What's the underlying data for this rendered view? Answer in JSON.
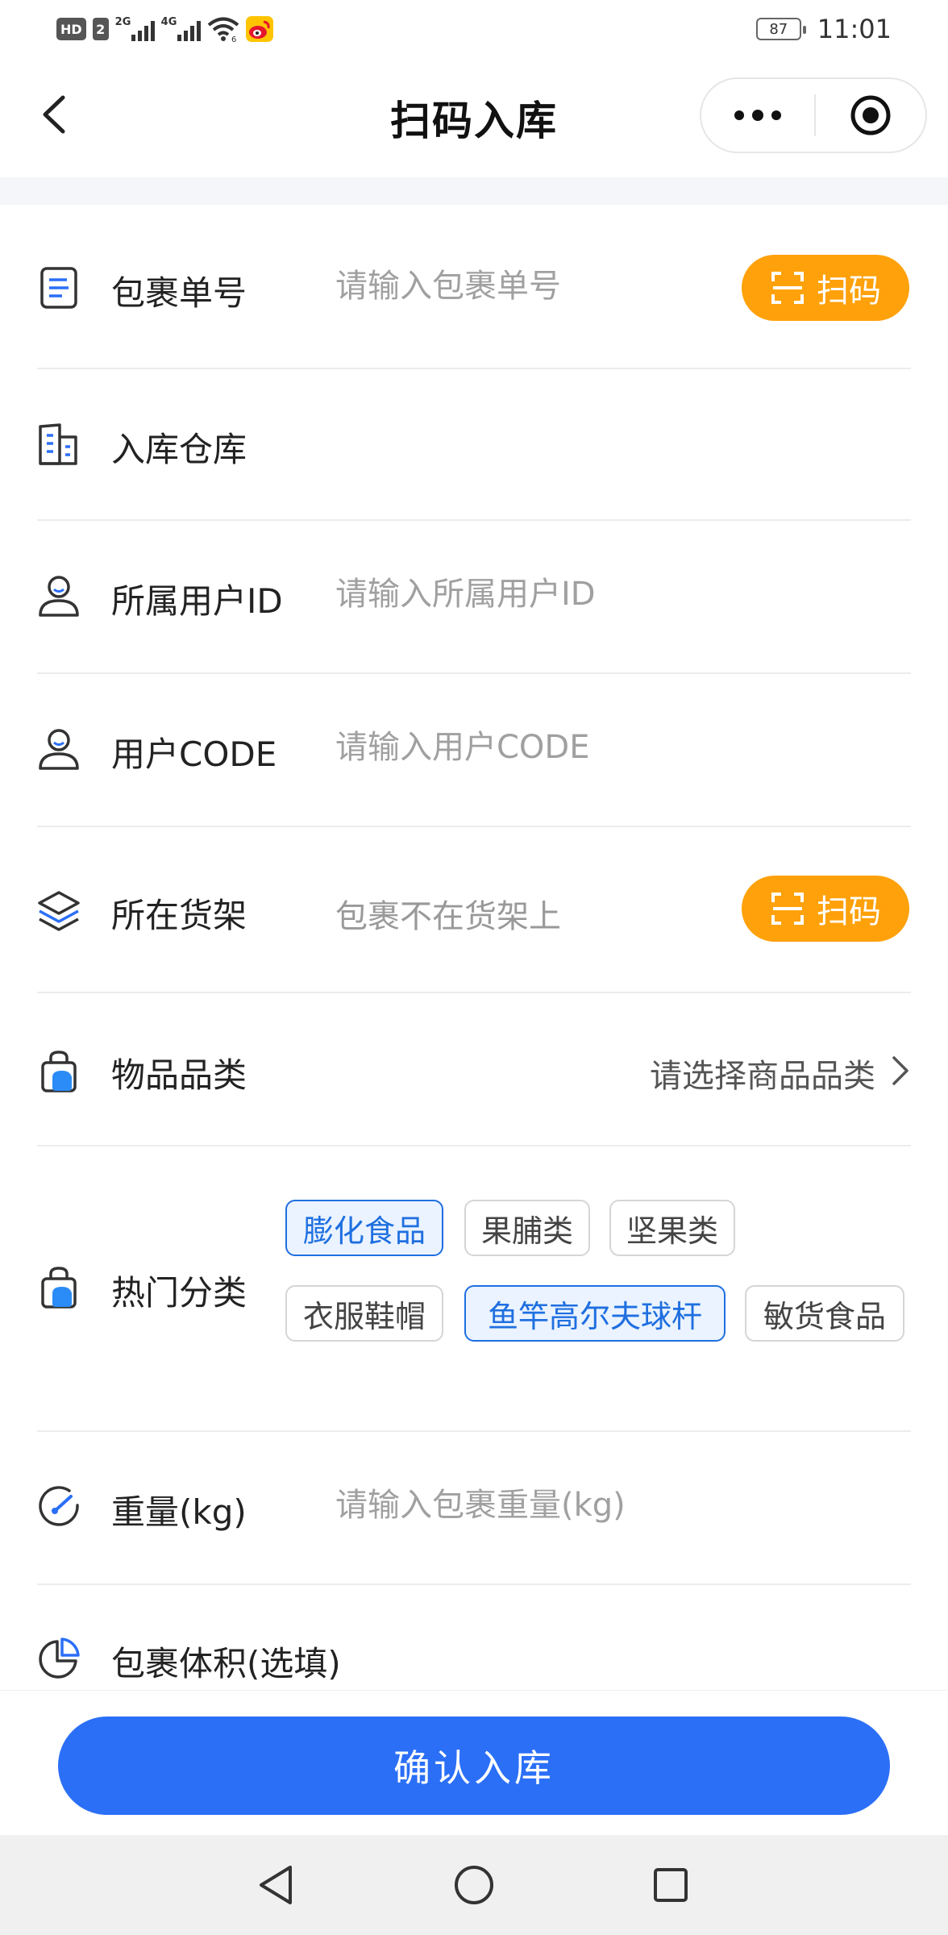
{
  "status_bar": {
    "hd_badge": "HD",
    "sim_number": "2",
    "signal_1_tag": "2G",
    "signal_2_tag": "4G",
    "battery": "87",
    "time": "11:01"
  },
  "nav": {
    "title": "扫码入库"
  },
  "form": {
    "parcel_no": {
      "label": "包裹单号",
      "placeholder": "请输入包裹单号",
      "scan_label": "扫码"
    },
    "warehouse": {
      "label": "入库仓库",
      "value": ""
    },
    "user_id": {
      "label": "所属用户ID",
      "placeholder": "请输入所属用户ID"
    },
    "user_code": {
      "label": "用户CODE",
      "placeholder": "请输入用户CODE"
    },
    "shelf": {
      "label": "所在货架",
      "value": "包裹不在货架上",
      "scan_label": "扫码"
    },
    "category": {
      "label": "物品品类",
      "value": "请选择商品品类"
    },
    "hot_category": {
      "label": "热门分类",
      "tags": [
        {
          "label": "膨化食品",
          "active": true
        },
        {
          "label": "果脯类",
          "active": false
        },
        {
          "label": "坚果类",
          "active": false
        },
        {
          "label": "衣服鞋帽",
          "active": false
        },
        {
          "label": "鱼竿高尔夫球杆",
          "active": true
        },
        {
          "label": "敏货食品",
          "active": false
        }
      ]
    },
    "weight": {
      "label": "重量(kg)",
      "placeholder": "请输入包裹重量(kg)"
    },
    "volume": {
      "label": "包裹体积(选填)"
    }
  },
  "footer": {
    "confirm_label": "确认入库"
  },
  "colors": {
    "primary": "#2b6ff7",
    "scan_orange": "#ffa10a",
    "tag_active": "#1f6fe0"
  }
}
